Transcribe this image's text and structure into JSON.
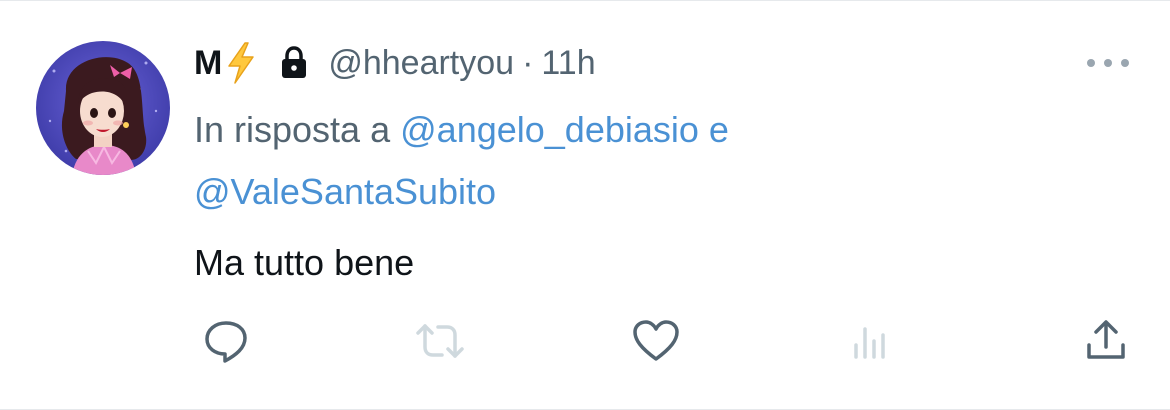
{
  "author": {
    "name": "M",
    "verified_emoji_icon": "high-voltage-icon",
    "lock_icon": "lock-icon",
    "handle": "@hheartyou",
    "separator": "·",
    "time": "11h"
  },
  "reply": {
    "prefix": "In risposta a",
    "mention_1": "@angelo_debiasio",
    "conjunction": "e",
    "mention_2": "@ValeSantaSubito"
  },
  "tweet": {
    "text": "Ma tutto bene"
  },
  "actions": [
    {
      "icon": "reply-icon"
    },
    {
      "icon": "retweet-icon"
    },
    {
      "icon": "like-icon"
    },
    {
      "icon": "views-icon"
    },
    {
      "icon": "share-icon"
    }
  ],
  "colors": {
    "text": "#0f1419",
    "secondary": "#536471",
    "link": "#4a91d4",
    "icon": "#536471",
    "icon_disabled": "#cfd9de"
  }
}
